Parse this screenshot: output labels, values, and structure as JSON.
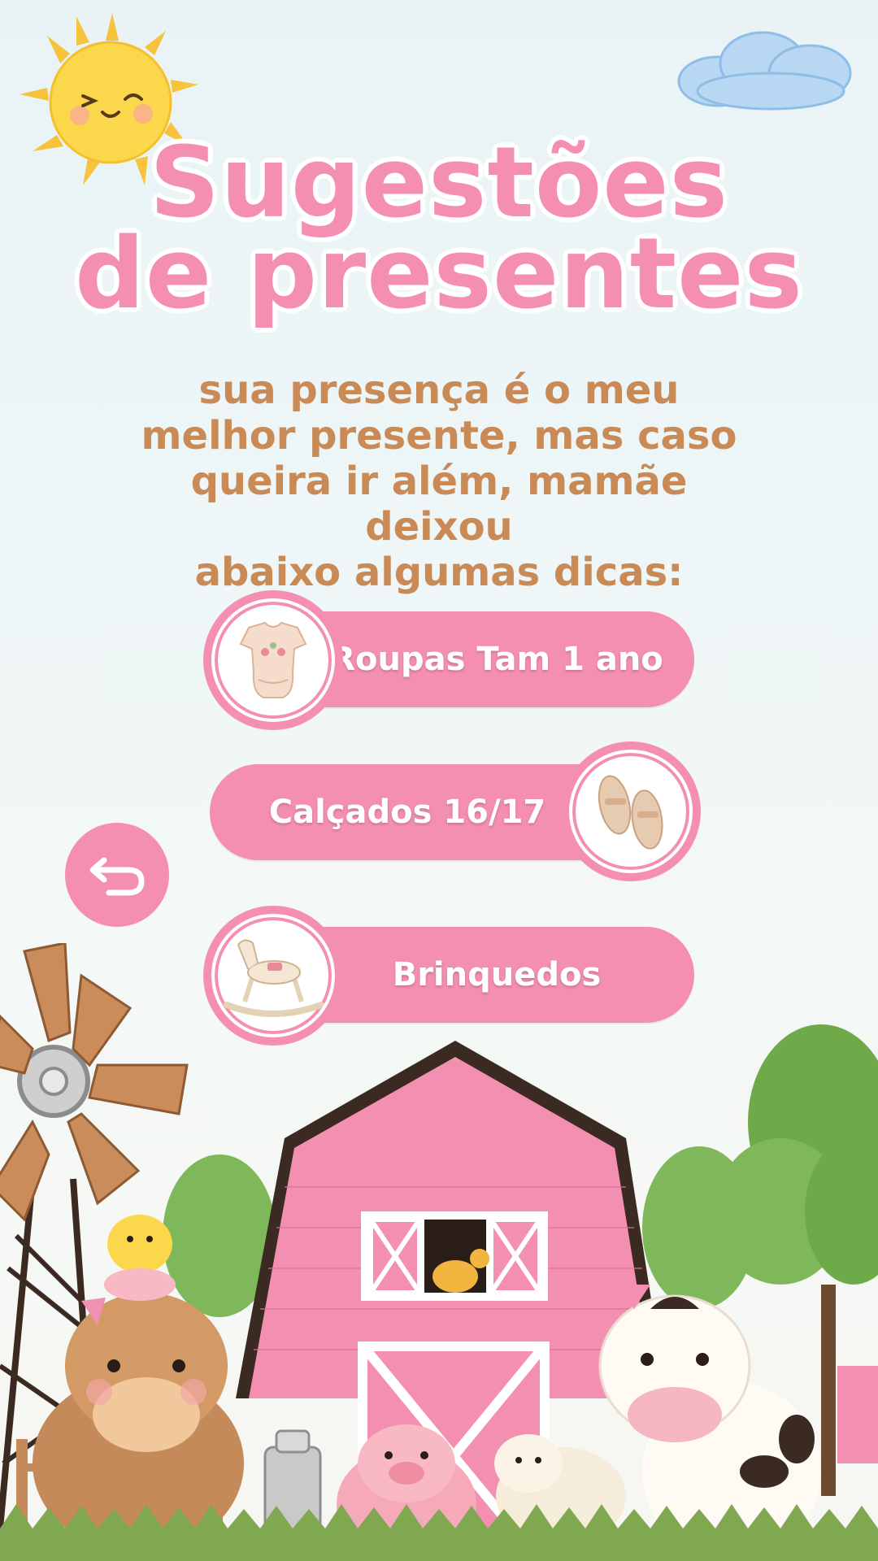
{
  "header": {
    "title_line1": "Sugestões",
    "title_line2": "de presentes",
    "subtitle_line1": "sua presença é o meu",
    "subtitle_line2": "melhor presente, mas caso",
    "subtitle_line3": "queira ir além, mamãe deixou",
    "subtitle_line4": "abaixo algumas dicas:"
  },
  "options": [
    {
      "label": "Roupas Tam 1 ano",
      "icon": "baby-clothes-icon"
    },
    {
      "label": "Calçados 16/17",
      "icon": "baby-shoes-icon"
    },
    {
      "label": "Brinquedos",
      "icon": "rocking-horse-icon"
    }
  ],
  "back_button": {
    "icon": "back-arrow-icon"
  },
  "colors": {
    "accent": "#f48fb1",
    "subtitle": "#c98a55",
    "background": "#eef6f7"
  }
}
